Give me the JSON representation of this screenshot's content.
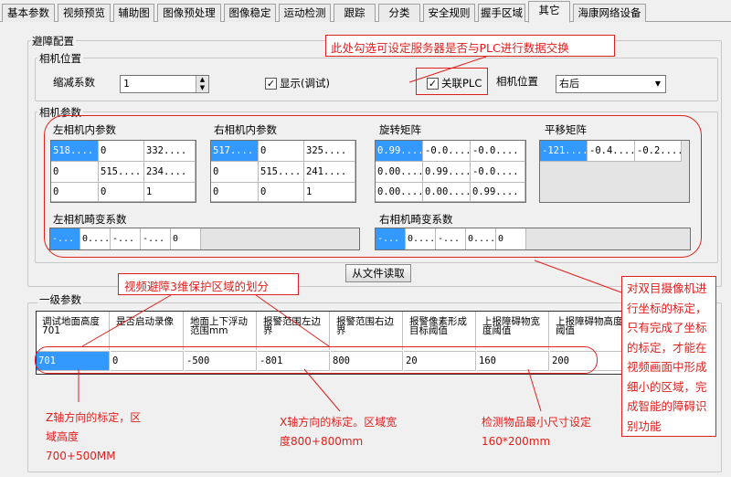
{
  "tabs": [
    "基本参数",
    "视频预览",
    "辅助图",
    "图像预处理",
    "图像稳定",
    "运动检测",
    "跟踪",
    "分类",
    "安全规则",
    "握手区域",
    "其它",
    "海康网络设备"
  ],
  "active_tab": "其它",
  "avoid": {
    "title": "避障配置",
    "camera_pos_group": "相机位置",
    "zoom_label": "缩减系数",
    "zoom_value": "1",
    "show_debug_label": "显示(调试)",
    "link_plc_label": "关联PLC",
    "camera_pos_label": "相机位置",
    "camera_pos_value": "右后"
  },
  "camera_params": {
    "group": "相机参数",
    "left_intrinsic": {
      "label": "左相机内参数",
      "cells": [
        "518....",
        "0",
        "332....",
        "0",
        "515....",
        "234....",
        "0",
        "0",
        "1"
      ]
    },
    "right_intrinsic": {
      "label": "右相机内参数",
      "cells": [
        "517....",
        "0",
        "325....",
        "0",
        "515....",
        "241....",
        "0",
        "0",
        "1"
      ]
    },
    "rotation": {
      "label": "旋转矩阵",
      "cells": [
        "0.99....",
        "-0.0....",
        "-0.0....",
        "0.00....",
        "0.99....",
        "-0.0....",
        "0.00....",
        "0.00....",
        "0.99...."
      ]
    },
    "translation": {
      "label": "平移矩阵",
      "cells": [
        "-121....",
        "-0.4....",
        "-0.2...."
      ]
    },
    "left_distortion": {
      "label": "左相机畸变系数",
      "cells": [
        "-...",
        "0....",
        "-...",
        "-...",
        "0"
      ]
    },
    "right_distortion": {
      "label": "右相机畸变系数",
      "cells": [
        "-...",
        "0....",
        "-...",
        "0....",
        "0"
      ]
    },
    "read_file_button": "从文件读取"
  },
  "level1": {
    "group": "一级参数",
    "headers": [
      "调试地面高度701",
      "是否启动录像",
      "地面上下浮动范围mm",
      "报警范围左边界",
      "报警范围右边界",
      "报警像素形成目标阈值",
      "上报障碍物宽度阈值",
      "上报障碍物高度阈值"
    ],
    "values": [
      "701",
      "0",
      "-500",
      "-801",
      "800",
      "20",
      "160",
      "200"
    ]
  },
  "annotations": {
    "plc_note": "此处勾选可设定服务器是否与PLC进行数据交换",
    "zone_note": "视频避障3维保护区域的划分",
    "calib_note": "对双目摄像机进行坐标的标定，只有完成了坐标的标定，才能在视频画面中形成细小的区域，完成智能的障碍识别功能",
    "z_note": "Z轴方向的标定，区域高度700+500MM",
    "x_note": "X轴方向的标定。区域宽度800+800mm",
    "size_note": "检测物品最小尺寸设定160*200mm"
  },
  "colors": {
    "annotation": "#e0201c",
    "selection": "#3399ff"
  }
}
